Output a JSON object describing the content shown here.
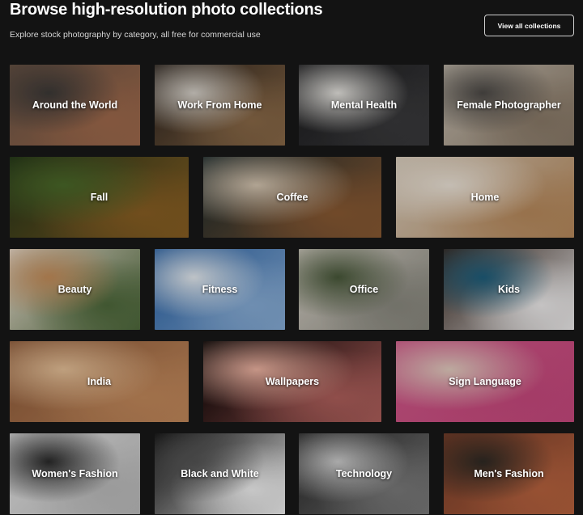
{
  "header": {
    "title": "Browse high-resolution photo collections",
    "subtitle": "Explore stock photography by category, all free for commercial use",
    "view_all_label": "View all collections"
  },
  "collections": [
    {
      "label": "Around the World",
      "image": "street-market-photo",
      "colors": [
        "#6b5546",
        "#a06a4c",
        "#3d3a38"
      ]
    },
    {
      "label": "Work From Home",
      "image": "desk-tray-photo",
      "colors": [
        "#2a221c",
        "#8b6a48",
        "#d9d4cc"
      ]
    },
    {
      "label": "Mental Health",
      "image": "journal-plant-photo",
      "colors": [
        "#1d1d1f",
        "#3a3a3c",
        "#e9e7e2"
      ]
    },
    {
      "label": "Female Photographer",
      "image": "mountain-road-photo",
      "colors": [
        "#c9c0b2",
        "#8b7b69",
        "#4d4a47"
      ]
    },
    {
      "label": "Fall",
      "image": "autumn-leaf-photo",
      "colors": [
        "#213318",
        "#8a6024",
        "#4b6a2a"
      ]
    },
    {
      "label": "Coffee",
      "image": "iced-latte-photo",
      "colors": [
        "#1b2a2c",
        "#8a5a33",
        "#d8c8b3"
      ]
    },
    {
      "label": "Home",
      "image": "window-sunlight-photo",
      "colors": [
        "#d9cdbc",
        "#b98b5d",
        "#efe6da"
      ]
    },
    {
      "label": "Beauty",
      "image": "cosmetics-flatlay-photo",
      "colors": [
        "#efe3d6",
        "#4f6a3c",
        "#c68f5b"
      ]
    },
    {
      "label": "Fitness",
      "image": "runner-snowfield-photo",
      "colors": [
        "#2a62a5",
        "#88aed8",
        "#e8eef3"
      ]
    },
    {
      "label": "Office",
      "image": "workspace-monitor-photo",
      "colors": [
        "#d8d2c8",
        "#8b8a80",
        "#49593a"
      ]
    },
    {
      "label": "Kids",
      "image": "child-chalkboard-photo",
      "colors": [
        "#3a2a22",
        "#f0eeee",
        "#1e5f7d"
      ]
    },
    {
      "label": "India",
      "image": "arched-hall-photo",
      "colors": [
        "#8d5a3a",
        "#c48a5c",
        "#e9c39a"
      ]
    },
    {
      "label": "Wallpapers",
      "image": "abstract-smoke-photo",
      "colors": [
        "#000000",
        "#b0605c",
        "#f1b6a4"
      ]
    },
    {
      "label": "Sign Language",
      "image": "hand-sign-photo",
      "colors": [
        "#d2578a",
        "#c94a7e",
        "#e6cfc2"
      ]
    },
    {
      "label": "Women's Fashion",
      "image": "woman-portrait-photo",
      "colors": [
        "#e8e8e8",
        "#bdbdbd",
        "#2a2a2a"
      ]
    },
    {
      "label": "Black and White",
      "image": "crosswalk-photo",
      "colors": [
        "#111111",
        "#f3f3f3",
        "#555555"
      ]
    },
    {
      "label": "Technology",
      "image": "mixing-console-photo",
      "colors": [
        "#252525",
        "#7b7b7b",
        "#cfcfcf"
      ]
    },
    {
      "label": "Men's Fashion",
      "image": "brick-wall-portrait-photo",
      "colors": [
        "#7a3f2a",
        "#b8633f",
        "#2f2a24"
      ]
    }
  ]
}
